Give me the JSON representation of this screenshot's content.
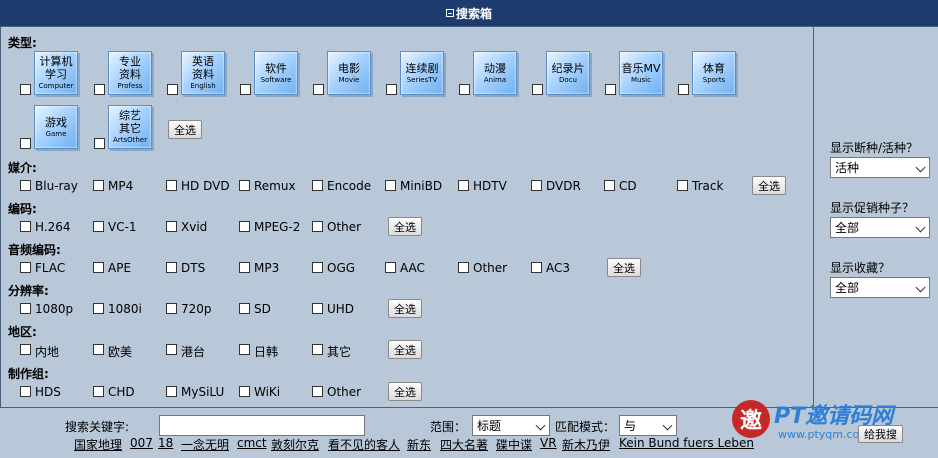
{
  "header": {
    "title": "搜索箱"
  },
  "type": {
    "label": "类型:",
    "tiles": [
      {
        "cn": "计算机学习",
        "cn1": "计算机",
        "cn2": "学习",
        "en": "Computer"
      },
      {
        "cn1": "专业",
        "cn2": "资料",
        "en": "Profess"
      },
      {
        "cn1": "英语",
        "cn2": "资料",
        "en": "English"
      },
      {
        "cn1": "软件",
        "cn2": "",
        "en": "Software"
      },
      {
        "cn1": "电影",
        "cn2": "",
        "en": "Movie"
      },
      {
        "cn1": "连续剧",
        "cn2": "",
        "en": "SeriesTV"
      },
      {
        "cn1": "动漫",
        "cn2": "",
        "en": "Anima"
      },
      {
        "cn1": "纪录片",
        "cn2": "",
        "en": "Docu"
      },
      {
        "cn1": "音乐MV",
        "cn2": "",
        "en": "Music"
      },
      {
        "cn1": "体育",
        "cn2": "",
        "en": "Sports"
      },
      {
        "cn1": "游戏",
        "cn2": "",
        "en": "Game"
      },
      {
        "cn1": "综艺",
        "cn2": "其它",
        "en": "ArtsOther"
      }
    ],
    "select_all": "全选"
  },
  "media": {
    "label": "媒介:",
    "options": [
      "Blu-ray",
      "MP4",
      "HD DVD",
      "Remux",
      "Encode",
      "MiniBD",
      "HDTV",
      "DVDR",
      "CD",
      "Track"
    ],
    "select_all": "全选"
  },
  "codec": {
    "label": "编码:",
    "options": [
      "H.264",
      "VC-1",
      "Xvid",
      "MPEG-2",
      "Other"
    ],
    "select_all": "全选"
  },
  "audio": {
    "label": "音频编码:",
    "options": [
      "FLAC",
      "APE",
      "DTS",
      "MP3",
      "OGG",
      "AAC",
      "Other",
      "AC3"
    ],
    "select_all": "全选"
  },
  "resolution": {
    "label": "分辨率:",
    "options": [
      "1080p",
      "1080i",
      "720p",
      "SD",
      "UHD"
    ],
    "select_all": "全选"
  },
  "region": {
    "label": "地区:",
    "options": [
      "内地",
      "欧美",
      "港台",
      "日韩",
      "其它"
    ],
    "select_all": "全选"
  },
  "team": {
    "label": "制作组:",
    "options": [
      "HDS",
      "CHD",
      "MySiLU",
      "WiKi",
      "Other"
    ],
    "select_all": "全选"
  },
  "sidebar": {
    "dead_label": "显示断种/活种？",
    "dead_value": "活种",
    "promo_label": "显示促销种子？",
    "promo_value": "全部",
    "bookmark_label": "显示收藏？",
    "bookmark_value": "全部"
  },
  "search": {
    "keyword_label": "搜索关键字:",
    "keyword_value": "",
    "scope_label": "范围：",
    "scope_value": "标题",
    "match_label": "匹配模式：",
    "match_value": "与",
    "submit": "给我搜"
  },
  "hot_keywords": [
    "国家地理",
    "007",
    "18",
    "一念无明",
    "cmct",
    "敦刻尔克",
    "看不见的客人",
    "新东",
    "四大名著",
    "碟中谍",
    "VR",
    "新木乃伊",
    "Kein Bund fuers Leben"
  ],
  "watermark": {
    "text": "PT邀请码网",
    "url": "www.ptyqm.com",
    "logo_char": "邀"
  },
  "colors": {
    "header_bg": "#1e3d6e",
    "page_bg": "#b8c8d8",
    "watermark": "#2f7fd6",
    "logo": "#c62828"
  }
}
